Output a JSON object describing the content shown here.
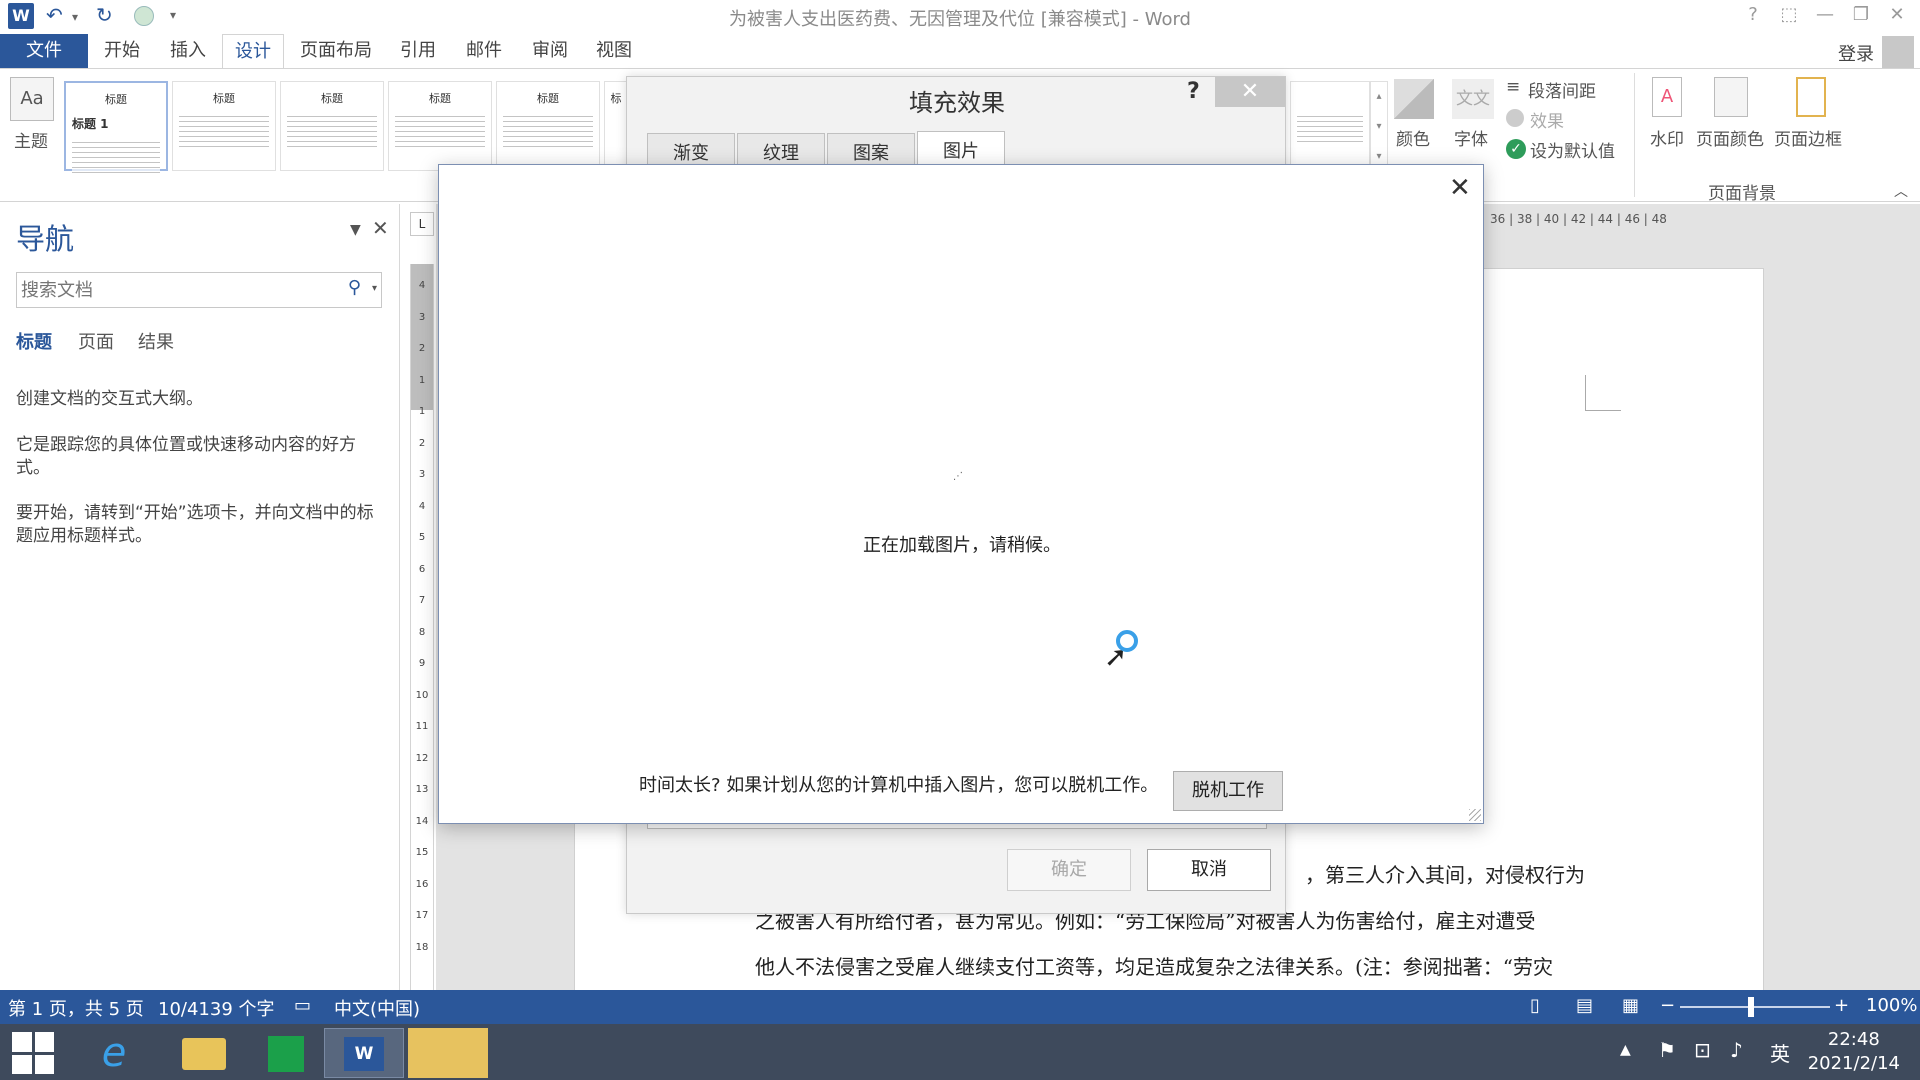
{
  "window": {
    "title": "为被害人支出医药费、无因管理及代位 [兼容模式] - Word",
    "controls": [
      "?",
      "⬚",
      "—",
      "❐",
      "✕"
    ]
  },
  "tabs": {
    "file": "文件",
    "items": [
      "开始",
      "插入",
      "设计",
      "页面布局",
      "引用",
      "邮件",
      "审阅",
      "视图"
    ],
    "active": "设计",
    "login": "登录"
  },
  "ribbon": {
    "theme_label": "主题",
    "style_thumbs": [
      "标题",
      "标题",
      "标题",
      "标题",
      "标题",
      "标"
    ],
    "style_heading": "标题 1",
    "colors_label": "颜色",
    "fonts_label": "字体",
    "fonts_sample": "文文",
    "para_spacing": "段落间距",
    "effects": "效果",
    "set_default": "设为默认值",
    "watermark": "水印",
    "page_color": "页面颜色",
    "page_border": "页面边框",
    "page_bg_group": "页面背景"
  },
  "nav": {
    "title": "导航",
    "search_placeholder": "搜索文档",
    "tabs": [
      "标题",
      "页面",
      "结果"
    ],
    "text1": "创建文档的交互式大纲。",
    "text2": "它是跟踪您的具体位置或快速移动内容的好方式。",
    "text3": "要开始，请转到“开始”选项卡，并向文档中的标题应用标题样式。"
  },
  "ruler": {
    "corner": "L",
    "h_numbers": "36 | 38 | 40 | 42 | 44 | 46 | 48",
    "v_numbers": [
      "4",
      "3",
      "2",
      "1",
      "1",
      "2",
      "3",
      "4",
      "5",
      "6",
      "7",
      "8",
      "9",
      "10",
      "11",
      "12",
      "13",
      "14",
      "15",
      "16",
      "17",
      "18"
    ]
  },
  "document": {
    "line1": "，第三人介入其间，对侵权行为",
    "line2": "之被害人有所给付者，甚为常见。例如：“劳工保险局”对被害人为伤害给付，雇主对遭受",
    "line3": "他人不法侵害之受雇人继续支付工资等，均足造成复杂之法律关系。(注：参阅拙著：“劳灾"
  },
  "fill_dialog": {
    "title": "填充效果",
    "help": "?",
    "tabs": [
      "渐变",
      "纹理",
      "图案",
      "图片"
    ],
    "active_tab": "图片",
    "ok": "确定",
    "cancel": "取消"
  },
  "load_dialog": {
    "close": "✕",
    "message": "正在加载图片，请稍候。",
    "offline_prompt": "时间太长? 如果计划从您的计算机中插入图片，您可以脱机工作。",
    "offline_button": "脱机工作"
  },
  "status": {
    "page": "第 1 页，共 5 页",
    "words": "10/4139 个字",
    "lang": "中文(中国)",
    "zoom": "100%"
  },
  "taskbar": {
    "ime": "英",
    "time": "22:48",
    "date": "2021/2/14"
  },
  "colors": {
    "accent": "#2b579a",
    "taskbar": "#3e4a5c",
    "spinner": "#3aa0e8"
  }
}
